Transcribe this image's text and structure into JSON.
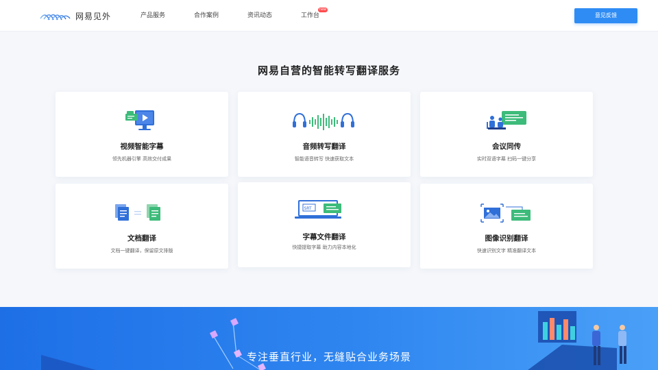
{
  "header": {
    "logo_text": "网易见外",
    "nav": [
      {
        "label": "产品服务"
      },
      {
        "label": "合作案例"
      },
      {
        "label": "资讯动态"
      },
      {
        "label": "工作台",
        "badge": "new"
      }
    ],
    "feedback_label": "意见反馈"
  },
  "section": {
    "title": "网易自营的智能转写翻译服务"
  },
  "cards": [
    {
      "title": "视频智能字幕",
      "desc": "领先机器引擎 高效交付成果",
      "icon": "video-monitor-icon"
    },
    {
      "title": "音频转写翻译",
      "desc": "智能语音转写 快速获取文本",
      "icon": "headphones-waveform-icon"
    },
    {
      "title": "会议同传",
      "desc": "实时双语字幕 扫码一键分享",
      "icon": "conference-speakers-icon"
    },
    {
      "title": "文档翻译",
      "desc": "文档一键翻译，保留原文排版",
      "icon": "document-translate-icon"
    },
    {
      "title": "字幕文件翻译",
      "desc": "快捷提取字幕 助力内容本地化",
      "icon": "srt-laptop-icon"
    },
    {
      "title": "图像识别翻译",
      "desc": "快速识别文字 精准翻译文本",
      "icon": "image-scan-icon"
    }
  ],
  "banner": {
    "title": "专注垂直行业，无缝贴合业务场景"
  },
  "colors": {
    "primary": "#2f8cf4",
    "accent_green": "#3dbb7a",
    "icon_blue": "#3b6fd8",
    "badge_red": "#ff4d4f"
  }
}
